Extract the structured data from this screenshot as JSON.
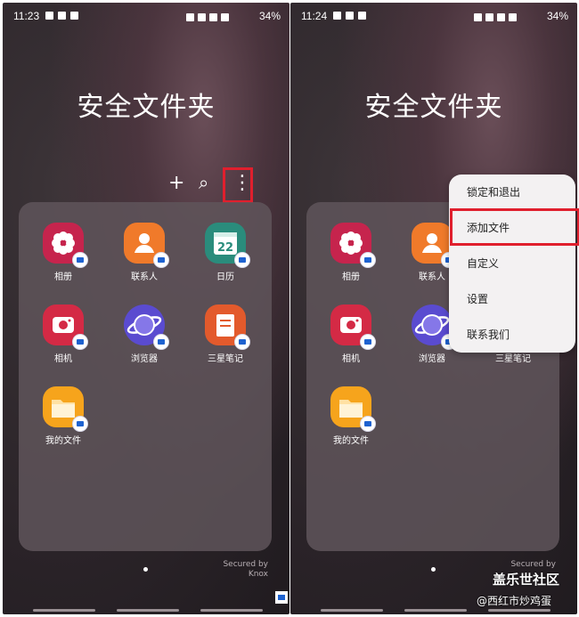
{
  "left_screen": {
    "status": {
      "time": "11:23",
      "battery": "34%"
    },
    "title": "安全文件夹",
    "toolbar": {
      "add": "+",
      "search": "⌕",
      "more": "⋮"
    },
    "apps": [
      {
        "label": "相册",
        "color": "#c6244d",
        "icon_name": "gallery-icon"
      },
      {
        "label": "联系人",
        "color": "#f07a2a",
        "icon_name": "contacts-icon"
      },
      {
        "label": "日历",
        "color": "#2a8c7c",
        "icon_name": "calendar-icon",
        "day": "22"
      },
      {
        "label": "相机",
        "color": "#d42a45",
        "icon_name": "camera-icon"
      },
      {
        "label": "浏览器",
        "color": "#5a4bd0",
        "icon_name": "browser-icon"
      },
      {
        "label": "三星笔记",
        "color": "#e35a2c",
        "icon_name": "notes-icon"
      },
      {
        "label": "我的文件",
        "color": "#f6a41c",
        "icon_name": "files-icon"
      }
    ],
    "secured_line1": "Secured by",
    "secured_line2": "Knox"
  },
  "right_screen": {
    "status": {
      "time": "11:24",
      "battery": "34%"
    },
    "title": "安全文件夹",
    "apps": [
      {
        "label": "相册"
      },
      {
        "label": "联系人"
      },
      {
        "label": "相机"
      },
      {
        "label": "浏览器"
      },
      {
        "label": "三星笔记"
      },
      {
        "label": "我的文件"
      }
    ],
    "menu": [
      "锁定和退出",
      "添加文件",
      "自定义",
      "设置",
      "联系我们"
    ],
    "secured_line1": "Secured by"
  },
  "watermark": {
    "line1": "盖乐世社区",
    "line2": "@西红市炒鸡蛋"
  },
  "colors": {
    "highlight": "#e01f2d",
    "badge": "#1e62d0"
  }
}
